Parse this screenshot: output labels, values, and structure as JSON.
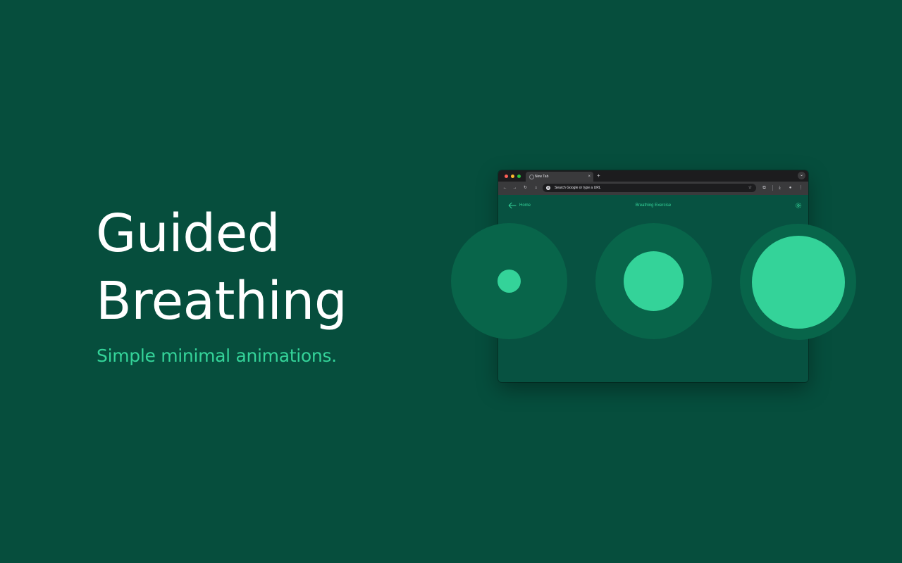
{
  "hero": {
    "title_line1": "Guided",
    "title_line2": "Breathing",
    "subtitle": "Simple minimal animations."
  },
  "browser": {
    "tab_title": "New Tab",
    "tab_close": "×",
    "new_tab": "+",
    "tab_menu": "⌄",
    "omnibox_icon": "G",
    "omnibox_placeholder": "Search Google or type a URL",
    "nav_icons": {
      "back": "←",
      "forward": "→",
      "reload": "↻",
      "home": "⌂",
      "star": "☆",
      "extensions": "⧉",
      "download": "⤓",
      "profile": "●",
      "menu": "⋮"
    }
  },
  "app": {
    "back_label": "Home",
    "page_title": "Breathing Exercise"
  },
  "colors": {
    "background": "#064e3d",
    "accent": "#34d399",
    "circle_track": "#08654a",
    "title": "#ffffff"
  },
  "breathing_states": [
    {
      "phase": "inhale-start",
      "inner_level": 0.2
    },
    {
      "phase": "mid",
      "inner_level": 0.52
    },
    {
      "phase": "full",
      "inner_level": 0.8
    }
  ]
}
